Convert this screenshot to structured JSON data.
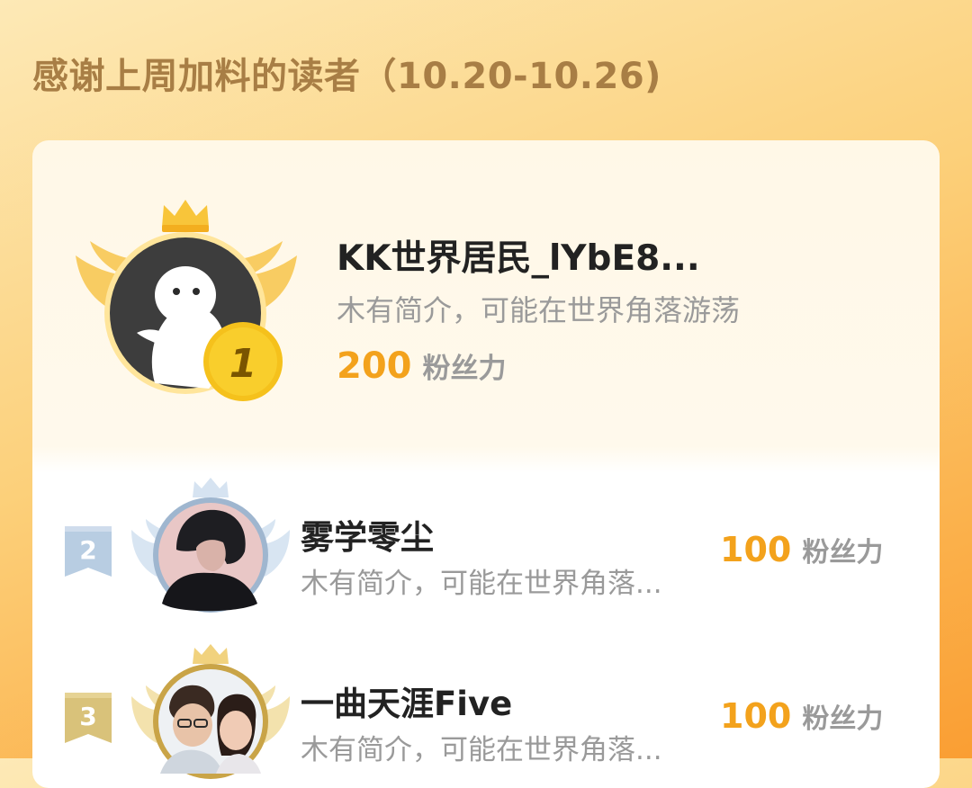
{
  "header": {
    "title": "感谢上周加料的读者（10.20-10.26)"
  },
  "leaderboard": {
    "score_unit": "粉丝力",
    "entries": [
      {
        "rank": "1",
        "name": "KK世界居民_lYbE8...",
        "bio": "木有简介，可能在世界角落游荡",
        "score": "200",
        "medal_color": "#f5c11c"
      },
      {
        "rank": "2",
        "name": "雾学零尘",
        "bio": "木有简介，可能在世界角落...",
        "score": "100",
        "medal_color": "#a9c0d8"
      },
      {
        "rank": "3",
        "name": "一曲天涯Five",
        "bio": "木有简介，可能在世界角落...",
        "score": "100",
        "medal_color": "#d7b85a"
      }
    ]
  },
  "icons": {
    "crown": "crown-icon",
    "wings": "wings-icon",
    "medal": "medal-icon",
    "rank_flag": "rank-flag-icon"
  }
}
